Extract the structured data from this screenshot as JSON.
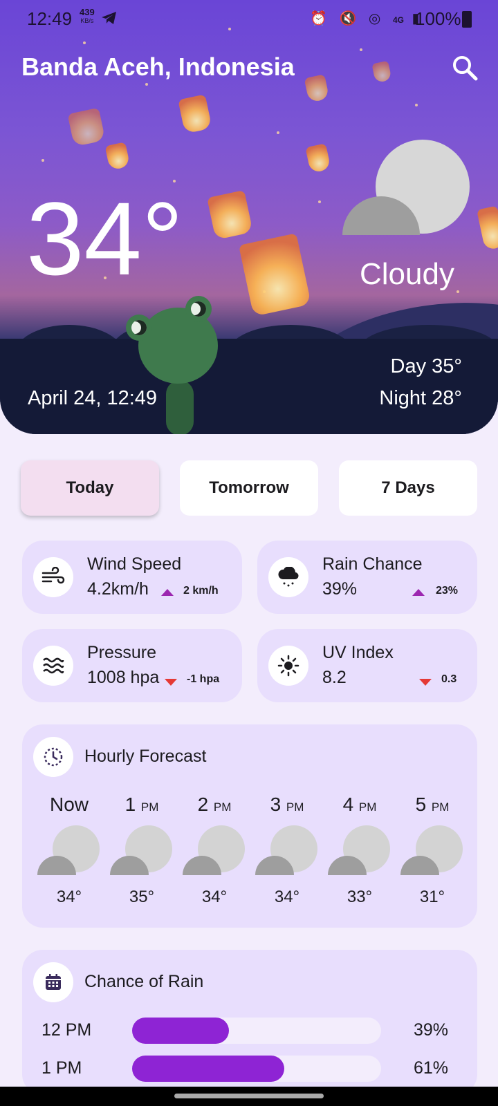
{
  "status_bar": {
    "time": "12:49",
    "speed_value": "439",
    "speed_unit": "KB/s",
    "network": "4G",
    "battery": "100%"
  },
  "header": {
    "city": "Banda Aceh, Indonesia",
    "search_icon": "search-icon"
  },
  "current": {
    "temperature": "34°",
    "condition": "Cloudy",
    "date_time": "April 24, 12:49",
    "day": "Day 35°",
    "night": "Night 28°"
  },
  "tabs": [
    {
      "label": "Today",
      "active": true
    },
    {
      "label": "Tomorrow",
      "active": false
    },
    {
      "label": "7 Days",
      "active": false
    }
  ],
  "stats": {
    "wind": {
      "label": "Wind Speed",
      "value": "4.2km/h",
      "delta": "2 km/h",
      "direction": "up",
      "icon": "wind-icon"
    },
    "rain": {
      "label": "Rain Chance",
      "value": "39%",
      "delta": "23%",
      "direction": "up",
      "icon": "rain-cloud-icon"
    },
    "pressure": {
      "label": "Pressure",
      "value": "1008 hpa",
      "delta": "-1 hpa",
      "direction": "down",
      "icon": "waves-icon"
    },
    "uv": {
      "label": "UV Index",
      "value": "8.2",
      "delta": "0.3",
      "direction": "down",
      "icon": "sun-icon"
    }
  },
  "hourly": {
    "title": "Hourly Forecast",
    "icon": "clock-icon",
    "items": [
      {
        "hour": "Now",
        "suffix": "",
        "temp": "34°"
      },
      {
        "hour": "1",
        "suffix": "PM",
        "temp": "35°"
      },
      {
        "hour": "2",
        "suffix": "PM",
        "temp": "34°"
      },
      {
        "hour": "3",
        "suffix": "PM",
        "temp": "34°"
      },
      {
        "hour": "4",
        "suffix": "PM",
        "temp": "33°"
      },
      {
        "hour": "5",
        "suffix": "PM",
        "temp": "31°"
      }
    ]
  },
  "rain_chance": {
    "title": "Chance of Rain",
    "icon": "calendar-icon",
    "rows": [
      {
        "label": "12 PM",
        "value": "39%",
        "fraction": 0.39
      },
      {
        "label": "1 PM",
        "value": "61%",
        "fraction": 0.61
      }
    ]
  },
  "colors": {
    "accent": "#8e24d4",
    "card": "#e8defd",
    "up": "#9c27b0",
    "down": "#e53935"
  }
}
